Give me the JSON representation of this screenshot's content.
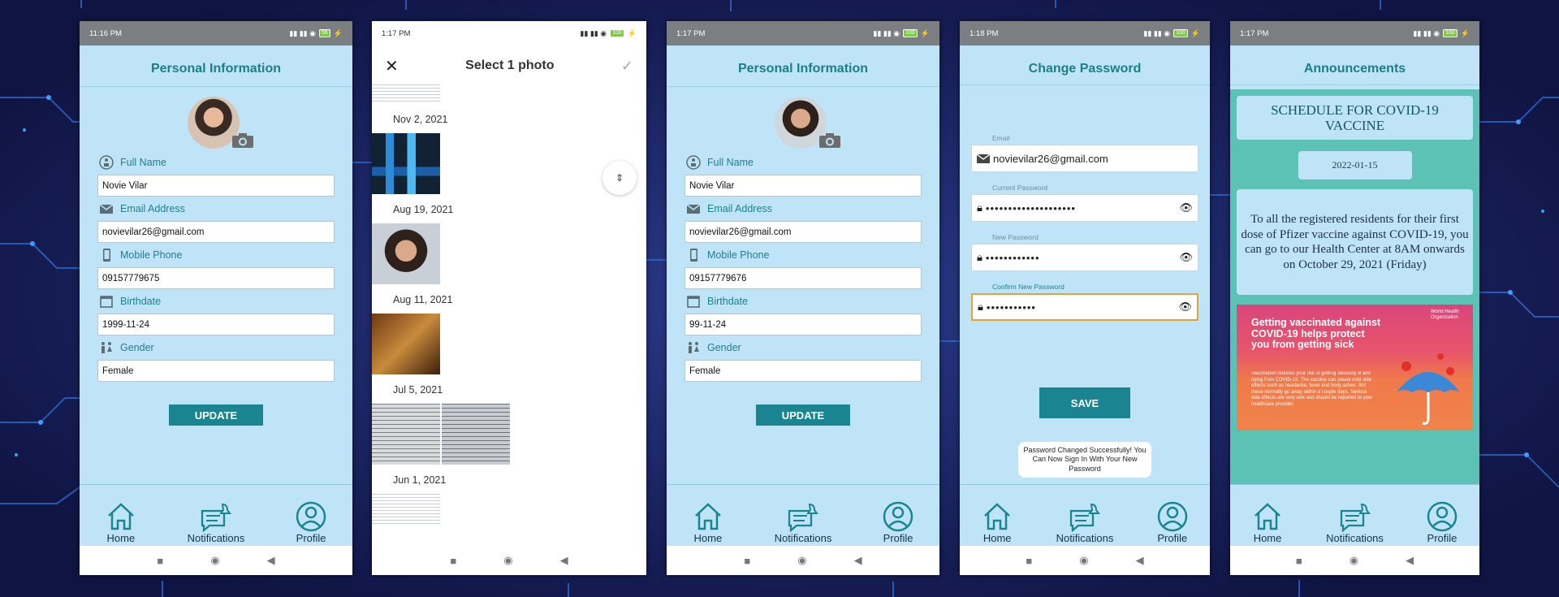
{
  "status": {
    "s1_time": "11:16 PM",
    "s2_time": "1:17 PM",
    "s3_time": "1:17 PM",
    "s4_time": "1:18 PM",
    "s5_time": "1:17 PM",
    "batt1": "56",
    "batt2": "100",
    "batt3": "100",
    "batt4": "100",
    "batt5": "100"
  },
  "profile_before": {
    "title": "Personal Information",
    "labels": {
      "full_name": "Full Name",
      "email": "Email Address",
      "phone": "Mobile Phone",
      "birthdate": "Birthdate",
      "gender": "Gender"
    },
    "values": {
      "full_name": "Novie Vilar",
      "email": "novievilar26@gmail.com",
      "phone": "09157779675",
      "birthdate": "1999-11-24",
      "gender": "Female"
    },
    "update_label": "UPDATE"
  },
  "picker": {
    "title": "Select 1 photo",
    "dates": [
      "Nov 2, 2021",
      "Aug 19, 2021",
      "Aug 11, 2021",
      "Jul 5, 2021",
      "Jun 1, 2021"
    ]
  },
  "profile_after": {
    "title": "Personal Information",
    "labels": {
      "full_name": "Full Name",
      "email": "Email Address",
      "phone": "Mobile Phone",
      "birthdate": "Birthdate",
      "gender": "Gender"
    },
    "values": {
      "full_name": "Novie Vilar",
      "email": "novievilar26@gmail.com",
      "phone": "09157779676",
      "birthdate": "99-11-24",
      "gender": "Female"
    },
    "update_label": "UPDATE"
  },
  "password": {
    "title": "Change Password",
    "email_label": "Email",
    "email_value": "novievilar26@gmail.com",
    "current_label": "Current Password",
    "current_value": "••••••••••••••••••••",
    "new_label": "New Password",
    "new_value": "••••••••••••",
    "confirm_label": "Confirm New Password",
    "confirm_value": "•••••••••••",
    "save_label": "SAVE",
    "toast": "Password Changed Successfully! You Can Now Sign In With Your New Password"
  },
  "announcements": {
    "title": "Announcements",
    "headline": "SCHEDULE FOR COVID-19 VACCINE",
    "date": "2022-01-15",
    "body": "To all the registered residents for their first dose of Pfizer vaccine against COVID-19, you can go to our Health Center at 8AM onwards on October 29, 2021 (Friday)",
    "poster_headline": "Getting vaccinated against COVID-19 helps protect you from getting sick",
    "poster_text": "Vaccination reduces your risk of getting seriously ill and dying from COVID-19. The vaccine can create mild side effects such as headache, fever and body aches. But these normally go away within a couple days. Serious side effects are very rare and should be reported to your healthcare provider.",
    "poster_org": "World Health Organization"
  },
  "nav": {
    "home": "Home",
    "notifications": "Notifications",
    "profile": "Profile"
  },
  "colors": {
    "accent": "#1a8590",
    "screen_bg": "#bfe4f8",
    "page_bg": "#13194a",
    "announcement_bg": "#5cc2b5"
  }
}
